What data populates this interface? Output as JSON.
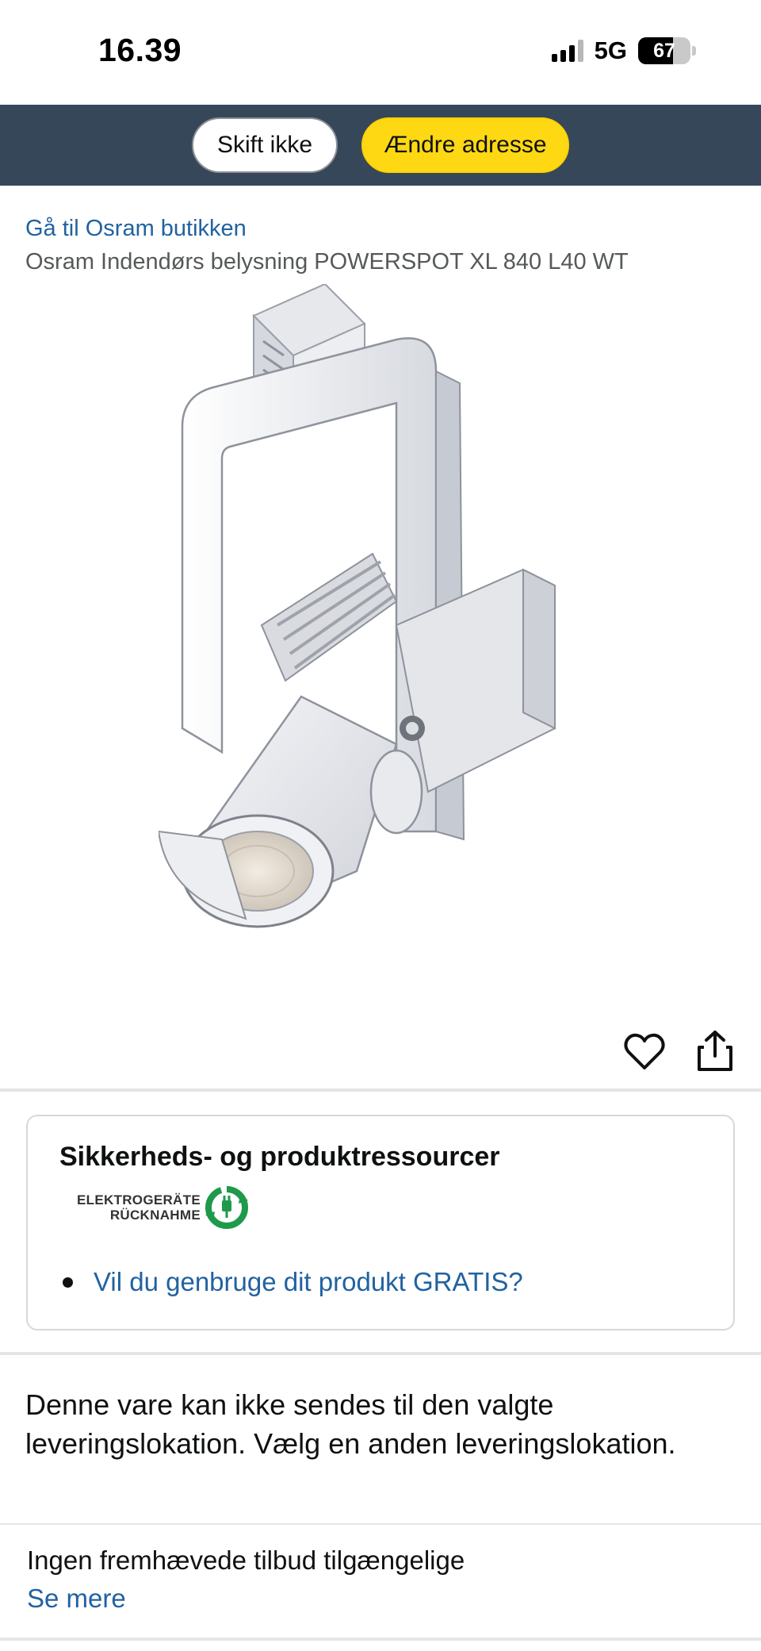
{
  "status_bar": {
    "time": "16.39",
    "network": "5G",
    "battery_level": "67"
  },
  "address_bar": {
    "dont_change_label": "Skift ikke",
    "change_address_label": "Ændre adresse"
  },
  "product": {
    "store_link": "Gå til Osram butikken",
    "title": "Osram Indendørs belysning POWERSPOT XL 840 L40 WT"
  },
  "actions": {
    "wishlist_icon": "heart-icon",
    "share_icon": "share-icon"
  },
  "safety_resources": {
    "title": "Sikkerheds- og produktressourcer",
    "logo_line1": "ELEKTROGERÄTE",
    "logo_line2": "RÜCKNAHME",
    "recycle_link": "Vil du genbruge dit produkt GRATIS?"
  },
  "delivery": {
    "message": "Denne vare kan ikke sendes til den valgte leveringslokation. Vælg en anden leveringslokation."
  },
  "offers": {
    "no_offers_text": "Ingen fremhævede tilbud tilgængelige",
    "see_more": "Se mere"
  },
  "colors": {
    "header_bg": "#37475a",
    "primary_button": "#ffd814",
    "link": "#2162a1"
  }
}
